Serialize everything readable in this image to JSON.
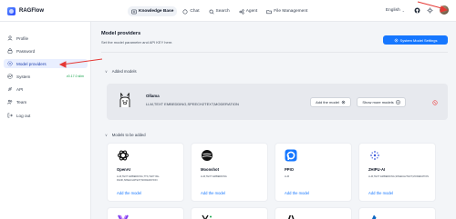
{
  "app": {
    "name": "RAGFlow"
  },
  "nav": [
    {
      "label": "Knowledge Base",
      "active": true,
      "icon": "knowledge-base-icon"
    },
    {
      "label": "Chat",
      "active": false,
      "icon": "chat-icon"
    },
    {
      "label": "Search",
      "active": false,
      "icon": "search-icon"
    },
    {
      "label": "Agent",
      "active": false,
      "icon": "agent-icon"
    },
    {
      "label": "File Management",
      "active": false,
      "icon": "folder-icon"
    }
  ],
  "header": {
    "language": "English",
    "icons": [
      "github-icon",
      "theme-icon",
      "avatar"
    ]
  },
  "sidebar": {
    "items": [
      {
        "label": "Profile",
        "icon": "user-icon",
        "active": false
      },
      {
        "label": "Password",
        "icon": "lock-icon",
        "active": false
      },
      {
        "label": "Model providers",
        "icon": "model-providers-icon",
        "active": true
      },
      {
        "label": "System",
        "icon": "system-icon",
        "active": false,
        "badge": "v0.17.0 slim"
      },
      {
        "label": "API",
        "icon": "api-icon",
        "active": false
      },
      {
        "label": "Team",
        "icon": "team-icon",
        "active": false
      },
      {
        "label": "Log out",
        "icon": "logout-icon",
        "active": false
      }
    ]
  },
  "main": {
    "title": "Model providers",
    "subtitle": "Set the model parameter and API KEY here.",
    "system_settings_label": "System Model Settings",
    "added_section_label": "Added models",
    "added": [
      {
        "name": "Ollama",
        "tags": "LLM,TEXT EMBEDDING,SPEECH2TEXT,MODERATION",
        "add_label": "Add the model",
        "show_more_label": "Show more models"
      }
    ],
    "tobe_section_label": "Models to be added",
    "providers": [
      {
        "name": "OpenAI",
        "tags": "LLM,TEXT EMBEDDING,TTS,TEXT RE-RANK,SPEECH2TEXT,MODERATION",
        "add_label": "Add the model",
        "icon": "openai-icon"
      },
      {
        "name": "Moonshot",
        "tags": "LLM,TEXT EMBEDDING",
        "add_label": "Add the model",
        "icon": "moonshot-icon"
      },
      {
        "name": "PPIO",
        "tags": "LLM",
        "add_label": "Add the model",
        "icon": "ppio-icon"
      },
      {
        "name": "ZHIPU-AI",
        "tags": "LLM,TEXT EMBEDDING,SPEECH2TEXT,MODERATION",
        "add_label": "Add the model",
        "icon": "zhipu-icon"
      }
    ],
    "partial_providers": [
      {
        "icon": "purple-provider-icon"
      },
      {
        "icon": "yi-icon"
      },
      {
        "icon": "anthropic-icon"
      },
      {
        "icon": "azure-icon"
      }
    ]
  },
  "colors": {
    "accent": "#1677ff",
    "active_bg": "#e9efff",
    "danger": "#ef4444",
    "annotation": "#e53935"
  }
}
